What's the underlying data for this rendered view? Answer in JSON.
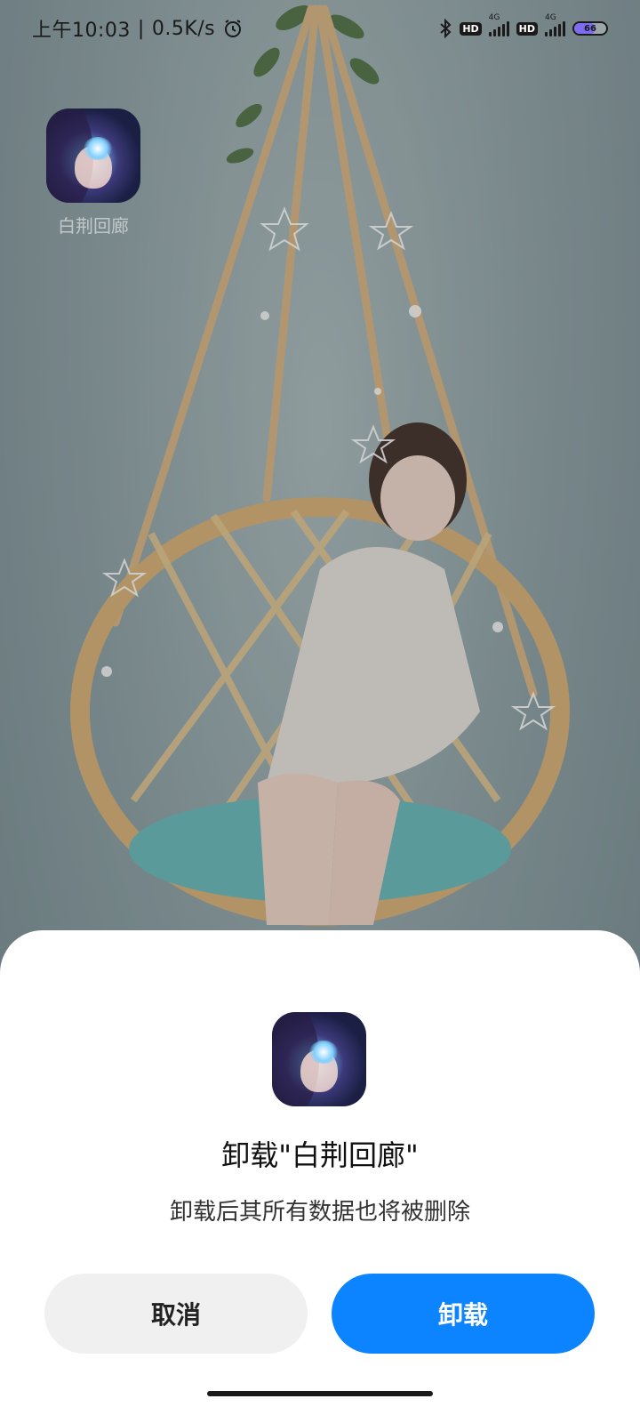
{
  "status_bar": {
    "time": "上午10:03",
    "separator": "|",
    "net_speed": "0.5K/s",
    "alarm_icon": "alarm-icon",
    "bluetooth_icon": "bluetooth-icon",
    "sim1": {
      "hd": "HD",
      "network": "4G"
    },
    "sim2": {
      "hd": "HD",
      "network": "4G"
    },
    "battery_level": "66",
    "battery_fill_fraction": 0.66
  },
  "home_screen": {
    "app_label": "白荆回廊"
  },
  "dialog": {
    "title": "卸载\"白荆回廊\"",
    "message": "卸载后其所有数据也将被删除",
    "cancel_label": "取消",
    "confirm_label": "卸载",
    "accent_color": "#0d84ff"
  }
}
